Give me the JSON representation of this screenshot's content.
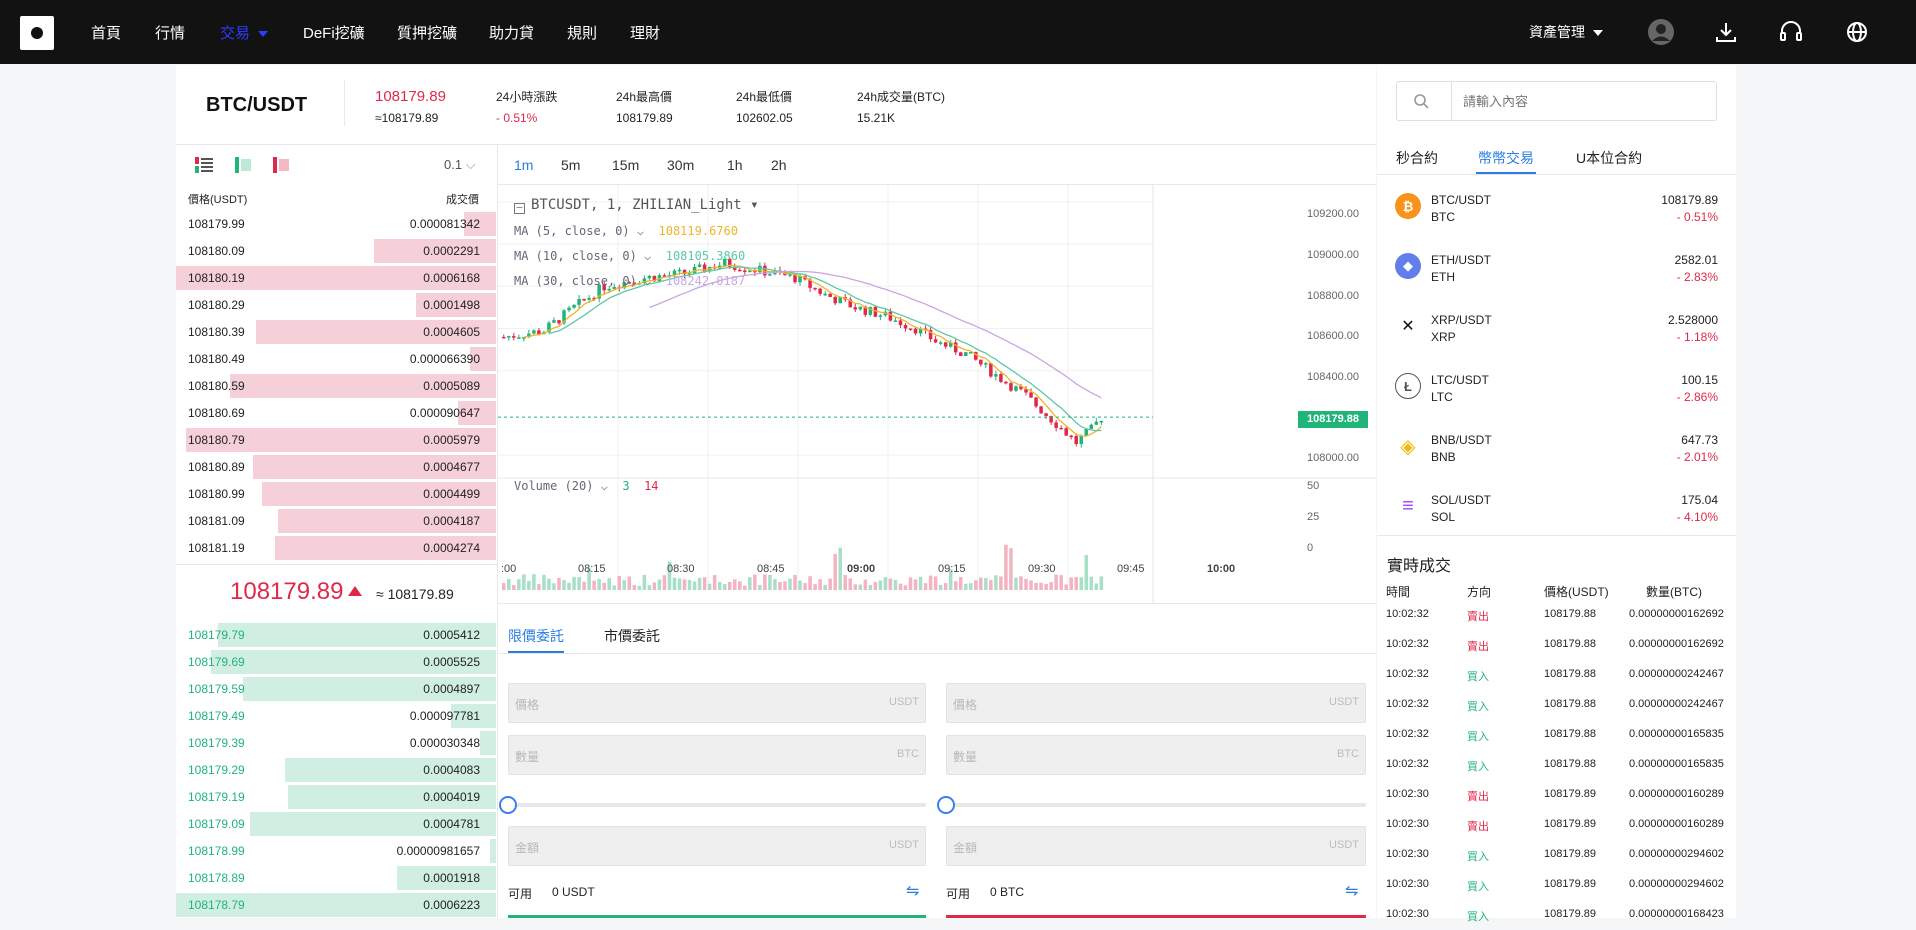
{
  "nav": {
    "items": [
      "首頁",
      "行情",
      "交易",
      "DeFi挖礦",
      "質押挖礦",
      "助力貸",
      "規則",
      "理財"
    ],
    "active_index": 2,
    "asset_menu": "資產管理"
  },
  "ticker": {
    "pair": "BTC/USDT",
    "price": "108179.89",
    "price_cny": "≈108179.89",
    "change_label": "24小時漲跌",
    "change_value": "- 0.51%",
    "high_label": "24h最高價",
    "high_value": "108179.89",
    "low_label": "24h最低價",
    "low_value": "102602.05",
    "vol_label": "24h成交量(BTC)",
    "vol_value": "15.21K"
  },
  "orderbook": {
    "precision": "0.1",
    "col_price": "價格(USDT)",
    "col_qty": "成交價",
    "asks": [
      {
        "p": "108179.99",
        "q": "0.000081342",
        "w": 0.1
      },
      {
        "p": "108180.09",
        "q": "0.0002291",
        "w": 0.38
      },
      {
        "p": "108180.19",
        "q": "0.0006168",
        "w": 1.0
      },
      {
        "p": "108180.29",
        "q": "0.0001498",
        "w": 0.25
      },
      {
        "p": "108180.39",
        "q": "0.0004605",
        "w": 0.75
      },
      {
        "p": "108180.49",
        "q": "0.000066390",
        "w": 0.08
      },
      {
        "p": "108180.59",
        "q": "0.0005089",
        "w": 0.83
      },
      {
        "p": "108180.69",
        "q": "0.000090647",
        "w": 0.12
      },
      {
        "p": "108180.79",
        "q": "0.0005979",
        "w": 0.97
      },
      {
        "p": "108180.89",
        "q": "0.0004677",
        "w": 0.76
      },
      {
        "p": "108180.99",
        "q": "0.0004499",
        "w": 0.73
      },
      {
        "p": "108181.09",
        "q": "0.0004187",
        "w": 0.68
      },
      {
        "p": "108181.19",
        "q": "0.0004274",
        "w": 0.69
      }
    ],
    "mid_price": "108179.89",
    "mid_approx": "≈ 108179.89",
    "bids": [
      {
        "p": "108179.79",
        "q": "0.0005412",
        "w": 0.87
      },
      {
        "p": "108179.69",
        "q": "0.0005525",
        "w": 0.89
      },
      {
        "p": "108179.59",
        "q": "0.0004897",
        "w": 0.79
      },
      {
        "p": "108179.49",
        "q": "0.000097781",
        "w": 0.14
      },
      {
        "p": "108179.39",
        "q": "0.000030348",
        "w": 0.05
      },
      {
        "p": "108179.29",
        "q": "0.0004083",
        "w": 0.66
      },
      {
        "p": "108179.19",
        "q": "0.0004019",
        "w": 0.65
      },
      {
        "p": "108179.09",
        "q": "0.0004781",
        "w": 0.77
      },
      {
        "p": "108178.99",
        "q": "0.00000981657",
        "w": 0.02
      },
      {
        "p": "108178.89",
        "q": "0.0001918",
        "w": 0.31
      },
      {
        "p": "108178.79",
        "q": "0.0006223",
        "w": 1.0
      }
    ]
  },
  "chart": {
    "timeframes": [
      "1m",
      "5m",
      "15m",
      "30m",
      "1h",
      "2h"
    ],
    "active_tf": 0,
    "symbol_line": "BTCUSDT, 1, ZHILIAN_Light",
    "ma5_label": "MA (5, close, 0)",
    "ma5_value": "108119.6760",
    "ma10_label": "MA (10, close, 0)",
    "ma10_value": "108105.3860",
    "ma30_label": "MA (30, close, 0)",
    "ma30_value": "108242.0187",
    "volume_label": "Volume (20)",
    "vol_up": "3",
    "vol_down": "14",
    "last_price_tag": "108179.88",
    "price_ticks": [
      "109200.00",
      "109000.00",
      "108800.00",
      "108600.00",
      "108400.00",
      "108000.00"
    ],
    "vol_ticks": [
      "50",
      "25",
      "0"
    ],
    "time_ticks": [
      ":00",
      "08:15",
      "08:30",
      "08:45",
      "09:00",
      "09:15",
      "09:30",
      "09:45",
      "10:00"
    ]
  },
  "chart_data": {
    "type": "candlestick",
    "ylim": [
      107920,
      109280
    ],
    "price_ticks": [
      109200,
      109000,
      108800,
      108600,
      108400,
      108000
    ],
    "time_range": [
      "08:00",
      "10:05"
    ],
    "time_ticks": [
      "08:00",
      "08:15",
      "08:30",
      "08:45",
      "09:00",
      "09:15",
      "09:30",
      "09:45",
      "10:00"
    ],
    "candle_count": 120,
    "last_price": 108179.88,
    "series": [
      {
        "name": "MA (5, close, 0)",
        "last": 108119.676,
        "color": "#f0b429"
      },
      {
        "name": "MA (10, close, 0)",
        "last": 108105.386,
        "color": "#5ec8a8"
      },
      {
        "name": "MA (30, close, 0)",
        "last": 108242.0187,
        "color": "#c9a6e4"
      }
    ],
    "path_points": [
      {
        "t": 0,
        "p": 108560
      },
      {
        "t": 8,
        "p": 108590
      },
      {
        "t": 14,
        "p": 108700
      },
      {
        "t": 20,
        "p": 108800
      },
      {
        "t": 28,
        "p": 108840
      },
      {
        "t": 36,
        "p": 108860
      },
      {
        "t": 44,
        "p": 108910
      },
      {
        "t": 50,
        "p": 108880
      },
      {
        "t": 58,
        "p": 108840
      },
      {
        "t": 64,
        "p": 108760
      },
      {
        "t": 70,
        "p": 108700
      },
      {
        "t": 76,
        "p": 108660
      },
      {
        "t": 82,
        "p": 108600
      },
      {
        "t": 86,
        "p": 108540
      },
      {
        "t": 92,
        "p": 108480
      },
      {
        "t": 98,
        "p": 108380
      },
      {
        "t": 104,
        "p": 108280
      },
      {
        "t": 110,
        "p": 108150
      },
      {
        "t": 114,
        "p": 108060
      },
      {
        "t": 117,
        "p": 108120
      },
      {
        "t": 119,
        "p": 108180
      }
    ],
    "volume_ylim": [
      0,
      50
    ],
    "volume_ticks": [
      50,
      25,
      0
    ],
    "volume_labels": {
      "up": 3,
      "down": 14
    }
  },
  "order": {
    "tab_limit": "限價委託",
    "tab_market": "市價委託",
    "price_label": "價格",
    "qty_label": "數量",
    "amount_label": "金額",
    "unit_usdt": "USDT",
    "unit_btc": "BTC",
    "avail_label": "可用",
    "avail_buy": "0 USDT",
    "avail_sell": "0 BTC",
    "buy_pct": 0,
    "sell_pct": 0
  },
  "market": {
    "search_placeholder": "請輸入內容",
    "tabs": [
      "秒合約",
      "幣幣交易",
      "U本位合約"
    ],
    "active_tab": 1,
    "rows": [
      {
        "pair": "BTC/USDT",
        "base": "BTC",
        "price": "108179.89",
        "change": "- 0.51%",
        "color": "#f7931a",
        "glyph": "₿"
      },
      {
        "pair": "ETH/USDT",
        "base": "ETH",
        "price": "2582.01",
        "change": "- 2.83%",
        "color": "#627eea",
        "glyph": "◆"
      },
      {
        "pair": "XRP/USDT",
        "base": "XRP",
        "price": "2.528000",
        "change": "- 1.18%",
        "color": "#ffffff",
        "glyph": "✕"
      },
      {
        "pair": "LTC/USDT",
        "base": "LTC",
        "price": "100.15",
        "change": "- 2.86%",
        "color": "#ffffff",
        "glyph": "Ł"
      },
      {
        "pair": "BNB/USDT",
        "base": "BNB",
        "price": "647.73",
        "change": "- 2.01%",
        "color": "#ffffff",
        "glyph": "◈"
      },
      {
        "pair": "SOL/USDT",
        "base": "SOL",
        "price": "175.04",
        "change": "- 4.10%",
        "color": "#ffffff",
        "glyph": "≡"
      }
    ]
  },
  "trades": {
    "title": "實時成交",
    "col_time": "時間",
    "col_side": "方向",
    "col_price": "價格(USDT)",
    "col_qty": "數量(BTC)",
    "rows": [
      {
        "t": "10:02:32",
        "s": "賣出",
        "p": "108179.88",
        "q": "0.00000000162692",
        "buy": false
      },
      {
        "t": "10:02:32",
        "s": "賣出",
        "p": "108179.88",
        "q": "0.00000000162692",
        "buy": false
      },
      {
        "t": "10:02:32",
        "s": "買入",
        "p": "108179.88",
        "q": "0.00000000242467",
        "buy": true
      },
      {
        "t": "10:02:32",
        "s": "買入",
        "p": "108179.88",
        "q": "0.00000000242467",
        "buy": true
      },
      {
        "t": "10:02:32",
        "s": "買入",
        "p": "108179.88",
        "q": "0.00000000165835",
        "buy": true
      },
      {
        "t": "10:02:32",
        "s": "買入",
        "p": "108179.88",
        "q": "0.00000000165835",
        "buy": true
      },
      {
        "t": "10:02:30",
        "s": "賣出",
        "p": "108179.89",
        "q": "0.00000000160289",
        "buy": false
      },
      {
        "t": "10:02:30",
        "s": "賣出",
        "p": "108179.89",
        "q": "0.00000000160289",
        "buy": false
      },
      {
        "t": "10:02:30",
        "s": "買入",
        "p": "108179.89",
        "q": "0.00000000294602",
        "buy": true
      },
      {
        "t": "10:02:30",
        "s": "買入",
        "p": "108179.89",
        "q": "0.00000000294602",
        "buy": true
      },
      {
        "t": "10:02:30",
        "s": "買入",
        "p": "108179.89",
        "q": "0.00000000168423",
        "buy": true
      }
    ]
  },
  "colors": {
    "up": "#21b47a",
    "down": "#e0294a",
    "accent": "#2a7de1",
    "nav_active": "#2a3eff"
  }
}
